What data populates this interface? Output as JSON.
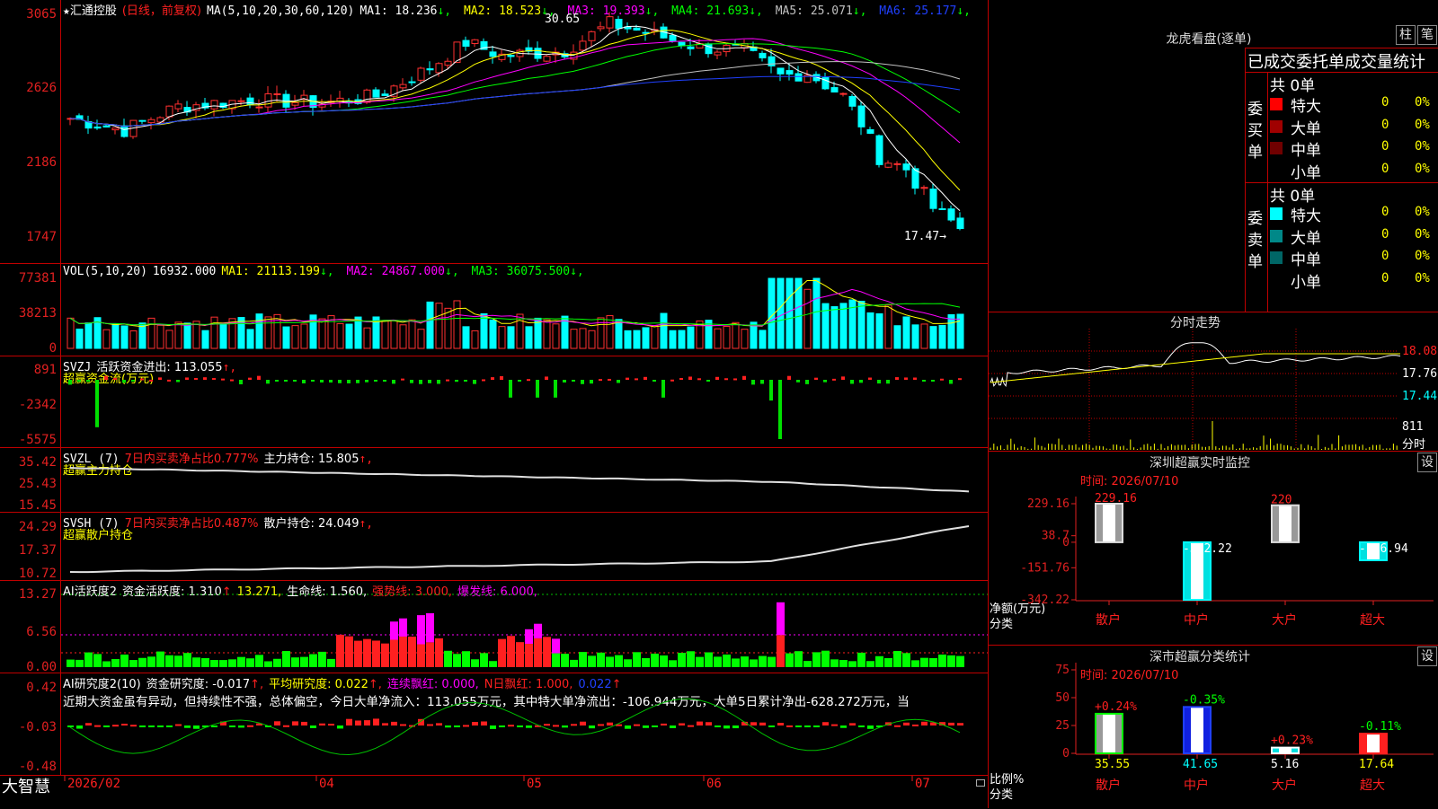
{
  "stock": {
    "star": "★",
    "name": "汇通控股",
    "period": "(日线，前复权)"
  },
  "price_panel": {
    "ma_label": "MA(5,10,20,30,60,120)",
    "ma": [
      {
        "label": "MA1: 18.236",
        "arrow": "↓",
        "color": "#ffffff"
      },
      {
        "label": "MA2: 18.523",
        "arrow": "↓",
        "color": "#ffff00"
      },
      {
        "label": "MA3: 19.393",
        "arrow": "↓",
        "color": "#ff00ff"
      },
      {
        "label": "MA4: 21.693",
        "arrow": "↓",
        "color": "#00ff00"
      },
      {
        "label": "MA5: 25.071",
        "arrow": "↓",
        "color": "#c0c0c0"
      },
      {
        "label": "MA6: 25.177",
        "arrow": "↓",
        "color": "#2040ff"
      }
    ],
    "y_labels": [
      "3065",
      "2626",
      "2186",
      "1747"
    ],
    "high_label": "30.65",
    "low_label": "17.47→"
  },
  "vol_panel": {
    "title": "VOL(5,10,20)",
    "value": "16932.000",
    "ma": [
      {
        "label": "MA1: 21113.199",
        "arrow": "↓",
        "color": "#ffff00"
      },
      {
        "label": "MA2: 24867.000",
        "arrow": "↓",
        "color": "#ff00ff"
      },
      {
        "label": "MA3: 36075.500",
        "arrow": "↓",
        "color": "#00ff00"
      }
    ],
    "y_labels": [
      "77381",
      "38213",
      "0"
    ]
  },
  "svzj_panel": {
    "title": "SVZJ",
    "label": "活跃资金进出: 113.055",
    "arrow": "↑,",
    "sub": "超赢资金流(万元)",
    "y_labels": [
      "891",
      "-2342",
      "-5575"
    ]
  },
  "svzl_panel": {
    "title": "SVZL (7)",
    "ratio": "7日内买卖净占比0.777%",
    "hold": "主力持仓: 15.805",
    "arrow": "↑,",
    "sub": "超赢主力持仓",
    "y_labels": [
      "35.42",
      "25.43",
      "15.45"
    ]
  },
  "svsh_panel": {
    "title": "SVSH (7)",
    "ratio": "7日内买卖净占比0.487%",
    "hold": "散户持仓: 24.049",
    "arrow": "↑,",
    "sub": "超赢散户持仓",
    "y_labels": [
      "24.29",
      "17.37",
      "10.72"
    ]
  },
  "ai_panel": {
    "title": "AI活跃度2",
    "active": "资金活跃度: 1.310",
    "active_val": "13.271,",
    "life": "生命线: 1.560,",
    "strong": "强势线: 3.000,",
    "burst": "爆发线: 6.000,",
    "y_labels": [
      "13.27",
      "6.56",
      "0.00"
    ]
  },
  "research_panel": {
    "title": "AI研究度2(10)",
    "research": "资金研究度: -0.017",
    "avg": "平均研究度: 0.022",
    "cont": "连续飘红: 0.000,",
    "nday": "N日飘红: 1.000,",
    "last": "0.022",
    "comment": "近期大资金虽有异动，但持续性不强，总体偏空，今日大单净流入：113.055万元，其中特大单净流出：-106.944万元，大单5日累计净出-628.272万元，当",
    "y_labels": [
      "0.42",
      "-0.03",
      "-0.48"
    ]
  },
  "bottom": {
    "brand": "大智慧",
    "dates": [
      "2026/02",
      "04",
      "05",
      "06",
      "07"
    ]
  },
  "dragon": {
    "title": "龙虎看盘(逐单)",
    "btn1": "柱",
    "btn2": "笔",
    "subtitle": "已成交委托单成交量统计",
    "buy": {
      "label": "委买单",
      "total": "共 0单",
      "rows": [
        {
          "name": "特大",
          "count": "0",
          "pct": "0%",
          "color": "#ff0000"
        },
        {
          "name": "大单",
          "count": "0",
          "pct": "0%",
          "color": "#a00000"
        },
        {
          "name": "中单",
          "count": "0",
          "pct": "0%",
          "color": "#700000"
        },
        {
          "name": "小单",
          "count": "0",
          "pct": "0%",
          "color": "#000000"
        }
      ]
    },
    "sell": {
      "label": "委卖单",
      "total": "共 0单",
      "rows": [
        {
          "name": "特大",
          "count": "0",
          "pct": "0%",
          "color": "#00ffff"
        },
        {
          "name": "大单",
          "count": "0",
          "pct": "0%",
          "color": "#008888"
        },
        {
          "name": "中单",
          "count": "0",
          "pct": "0%",
          "color": "#006666"
        },
        {
          "name": "小单",
          "count": "0",
          "pct": "0%",
          "color": "#000000"
        }
      ]
    }
  },
  "intraday": {
    "title": "分时走势",
    "y_labels": [
      "18.08",
      "17.76",
      "17.44"
    ],
    "vol_label": "811",
    "vol_unit": "分时"
  },
  "sz_monitor": {
    "title": "深圳超赢实时监控",
    "btn": "设",
    "time": "时间: 2026/07/10",
    "y_labels": [
      "229.16",
      "38.7",
      "0",
      "-151.76",
      "-342.22"
    ],
    "unit_label": "净额(万元)",
    "cat_label": "分类",
    "chart_data": {
      "type": "bar",
      "categories": [
        "散户",
        "中户",
        "大户",
        "超大"
      ],
      "values": [
        229.16,
        -342.22,
        220,
        -106.94
      ],
      "value_labels": [
        "229.16",
        "-342.22",
        "220",
        "-106.94"
      ],
      "ylim": [
        -342.22,
        229.16
      ]
    }
  },
  "sz_class": {
    "title": "深市超赢分类统计",
    "btn": "设",
    "time": "时间: 2026/07/10",
    "y_labels": [
      "75",
      "50",
      "25",
      "0"
    ],
    "unit_label": "比例%",
    "cat_label": "分类",
    "chart_data": {
      "type": "bar",
      "categories": [
        "散户",
        "中户",
        "大户",
        "超大"
      ],
      "values": [
        35.55,
        41.65,
        5.16,
        17.64
      ],
      "changes": [
        "+0.24%",
        "-0.35%",
        "+0.23%",
        "-0.11%"
      ],
      "value_labels": [
        "35.55",
        "41.65",
        "5.16",
        "17.64"
      ],
      "ylim": [
        0,
        75
      ]
    }
  }
}
